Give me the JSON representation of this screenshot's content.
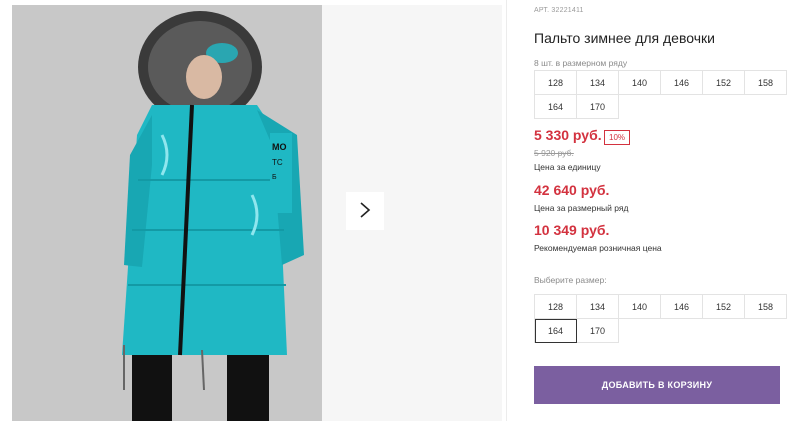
{
  "product": {
    "article": "АРТ. 32221411",
    "title": "Пальто зимнее для девочки"
  },
  "pack": {
    "caption": "8 шт. в размерном ряду",
    "sizes": [
      "128",
      "134",
      "140",
      "146",
      "152",
      "158",
      "164",
      "170"
    ]
  },
  "pricing": {
    "unit_price": "5 330 руб.",
    "discount": "10%",
    "old_price": "5 920 руб.",
    "unit_label": "Цена за единицу",
    "row_price": "42 640 руб.",
    "row_label": "Цена за размерный ряд",
    "retail_price": "10 349 руб.",
    "retail_label": "Рекомендуемая розничная цена"
  },
  "size_select": {
    "caption": "Выберите размер:",
    "sizes": [
      "128",
      "134",
      "140",
      "146",
      "152",
      "158",
      "164",
      "170"
    ],
    "selected": "164"
  },
  "cart": {
    "add_label": "ДОБАВИТЬ В КОРЗИНУ"
  },
  "colors": {
    "accent": "#7b5fa0",
    "price": "#d3323f",
    "coat": "#1fb8c4"
  },
  "icons": {
    "next": "chevron-right-icon"
  }
}
